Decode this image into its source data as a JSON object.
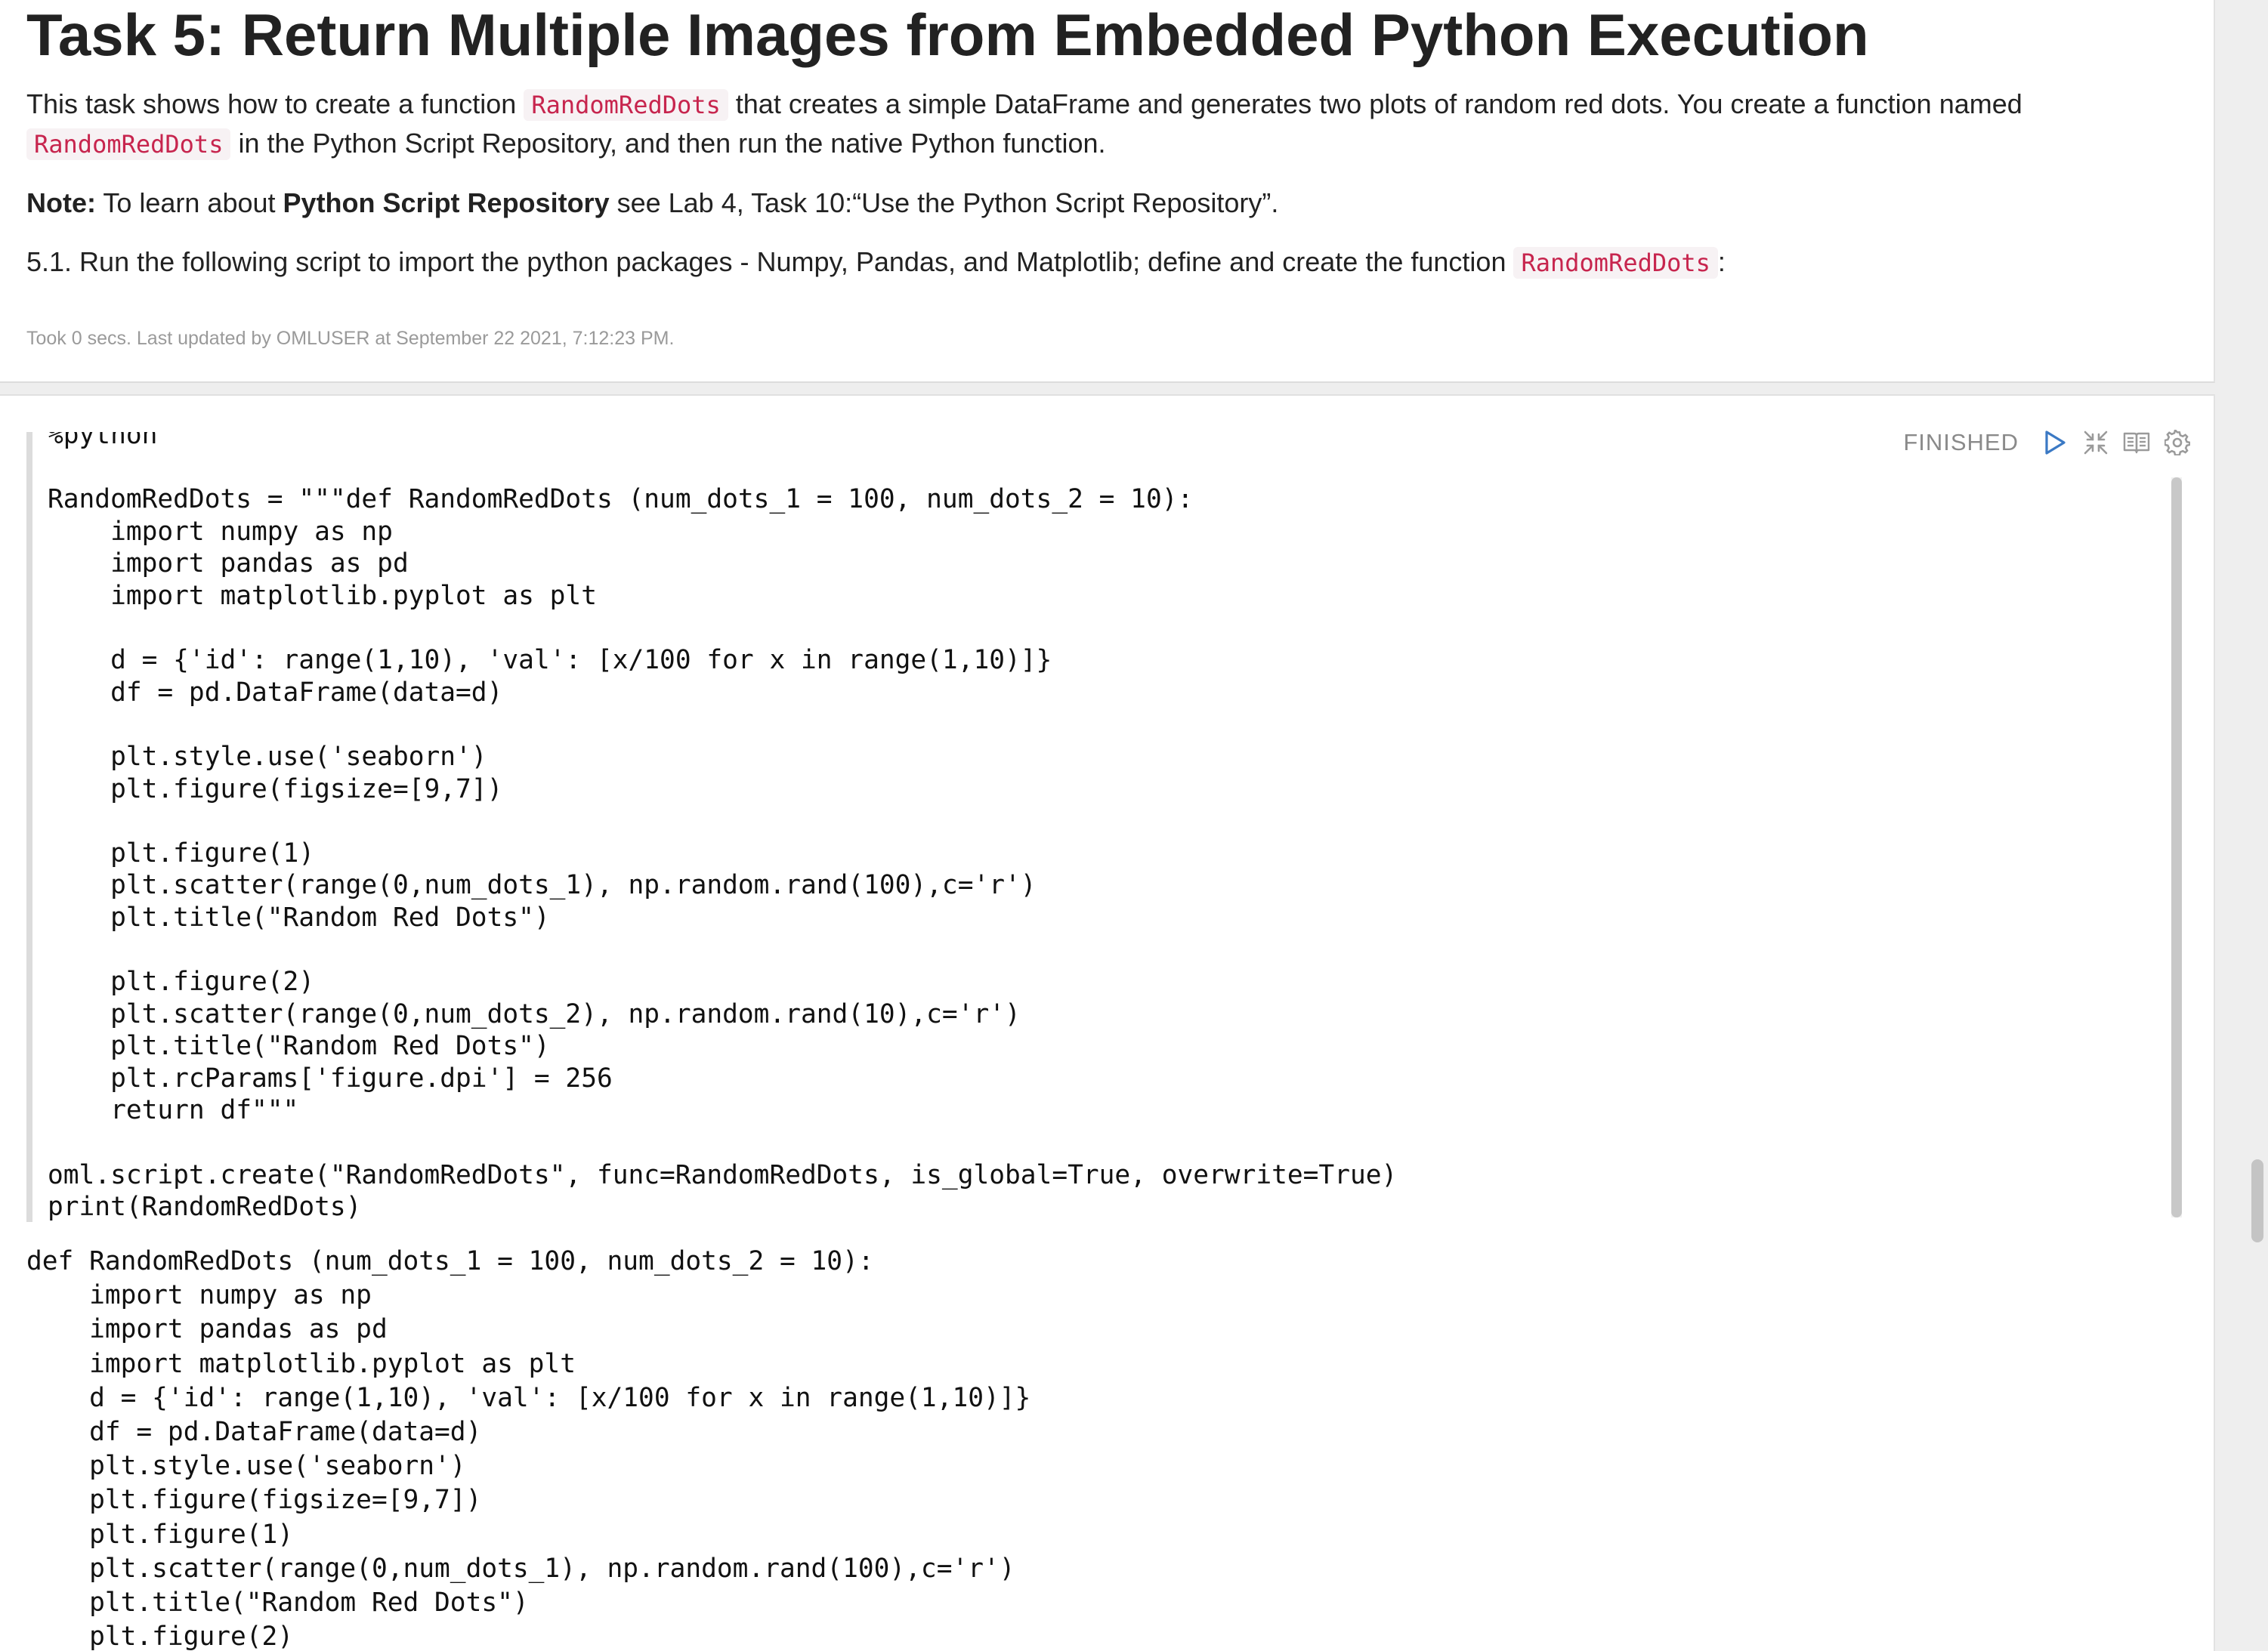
{
  "task": {
    "heading": "Task 5: Return Multiple Images from Embedded Python Execution",
    "intro_part1": "This task shows how to create a function ",
    "intro_code1": "RandomRedDots",
    "intro_part2": " that creates a simple DataFrame and generates two plots of random red dots. You create a function named",
    "intro_code2": "RandomRedDots",
    "intro_part3": " in the Python Script Repository, and then run the native Python function.",
    "note_label": "Note:",
    "note_part1": " To learn about ",
    "note_bold": "Python Script Repository",
    "note_part2": " see Lab 4, Task 10:“Use the Python Script Repository”.",
    "step_text": "5.1. Run the following script to import the python packages - Numpy, Pandas, and Matplotlib; define and create the function ",
    "step_code": "RandomRedDots",
    "step_end": ":",
    "took": "Took 0 secs. Last updated by OMLUSER at September 22 2021, 7:12:23 PM."
  },
  "paragraph": {
    "status": "FINISHED",
    "icons": {
      "run": "run-play-icon",
      "hide_editor": "collapse-arrows-icon",
      "show_output": "book-icon",
      "settings": "gear-icon"
    },
    "editor_code": "%python\n\nRandomRedDots = \"\"\"def RandomRedDots (num_dots_1 = 100, num_dots_2 = 10):\n    import numpy as np\n    import pandas as pd\n    import matplotlib.pyplot as plt\n\n    d = {'id': range(1,10), 'val': [x/100 for x in range(1,10)]}\n    df = pd.DataFrame(data=d)\n\n    plt.style.use('seaborn')\n    plt.figure(figsize=[9,7])\n\n    plt.figure(1)\n    plt.scatter(range(0,num_dots_1), np.random.rand(100),c='r')\n    plt.title(\"Random Red Dots\")\n\n    plt.figure(2)\n    plt.scatter(range(0,num_dots_2), np.random.rand(10),c='r')\n    plt.title(\"Random Red Dots\")\n    plt.rcParams['figure.dpi'] = 256\n    return df\"\"\"\n\noml.script.create(\"RandomRedDots\", func=RandomRedDots, is_global=True, overwrite=True)\nprint(RandomRedDots)",
    "output_text": "def RandomRedDots (num_dots_1 = 100, num_dots_2 = 10):\n    import numpy as np\n    import pandas as pd\n    import matplotlib.pyplot as plt\n    d = {'id': range(1,10), 'val': [x/100 for x in range(1,10)]}\n    df = pd.DataFrame(data=d)\n    plt.style.use('seaborn')\n    plt.figure(figsize=[9,7])\n    plt.figure(1)\n    plt.scatter(range(0,num_dots_1), np.random.rand(100),c='r')\n    plt.title(\"Random Red Dots\")\n    plt.figure(2)"
  },
  "colors": {
    "inline_code": "#c7254e",
    "run_icon": "#3b79c4",
    "status": "#8a8a8a"
  }
}
